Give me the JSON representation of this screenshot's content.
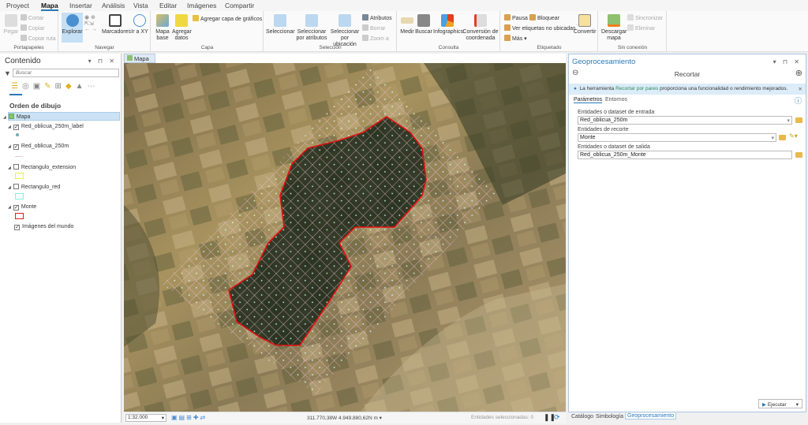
{
  "ribbon_tabs": [
    "Proyect",
    "Mapa",
    "Insertar",
    "Análisis",
    "Vista",
    "Editar",
    "Imágenes",
    "Compartir"
  ],
  "active_tab": "Mapa",
  "groups": {
    "portapapeles": {
      "label": "Portapapeles",
      "pegar": "Pegar",
      "cortar": "Cortar",
      "copiar": "Copiar",
      "copiar_ruta": "Copiar ruta"
    },
    "navegar": {
      "label": "Navegar",
      "explorar": "Explorar",
      "marcadores": "Marcadores",
      "ir_xy": "Ir a XY"
    },
    "capa": {
      "label": "Capa",
      "mapa_base": "Mapa base",
      "agregar_datos": "Agregar datos",
      "agregar_capa_graficos": "Agregar capa de gráficos"
    },
    "seleccion": {
      "label": "Selección",
      "seleccionar": "Seleccionar",
      "por_atributos": "Seleccionar por atributos",
      "por_ubicacion": "Seleccionar por ubicación",
      "atributos": "Atributos",
      "borrar": "Borrar",
      "zoom_a": "Zoom a"
    },
    "consulta": {
      "label": "Consulta",
      "medir": "Medir",
      "buscar": "Buscar",
      "infographics": "Infographics",
      "conversion": "Conversión de coordenada"
    },
    "etiquetado": {
      "label": "Etiquetado",
      "pausa": "Pausa",
      "bloquear": "Bloquear",
      "ver_etiquetas": "Ver etiquetas no ubicadas",
      "mas": "Más",
      "convertir": "Convertir"
    },
    "sin_conexion": {
      "label": "Sin conexión",
      "descargar": "Descargar mapa",
      "sincronizar": "Sincronizar",
      "eliminar": "Eliminar"
    }
  },
  "contents": {
    "title": "Contenido",
    "search_placeholder": "Buscar",
    "drawing_order": "Orden de dibujo",
    "layers": [
      {
        "name": "Mapa",
        "checked": true
      },
      {
        "name": "Red_oblicua_250m_label",
        "checked": true
      },
      {
        "name": "Red_oblicua_250m",
        "checked": true
      },
      {
        "name": "Rectangulo_extension",
        "checked": false,
        "color": "#f5f040"
      },
      {
        "name": "Rectangulo_red",
        "checked": false,
        "color": "#7ff0e0"
      },
      {
        "name": "Monte",
        "checked": true,
        "color": "#e02020"
      },
      {
        "name": "Imágenes del mundo",
        "checked": true
      }
    ]
  },
  "map": {
    "tab": "Mapa",
    "grid_color": "#f0c8d8",
    "monte_color": "#e01010"
  },
  "status": {
    "scale": "1:32.000",
    "coords": "311.770,38W 4.949.880,62N m",
    "selected": "Entidades seleccionadas: 0"
  },
  "geoproc": {
    "title": "Geoprocesamiento",
    "tool": "Recortar",
    "info_pre": "La herramienta ",
    "info_link": "Recortar por pares",
    "info_post": " proporciona una funcionalidad o rendimiento mejorados.",
    "tabs": [
      "Parámetros",
      "Entornos"
    ],
    "in_label": "Entidades o dataset de entrada",
    "in_value": "Red_oblicua_250m",
    "clip_label": "Entidades de recorte",
    "clip_value": "Monte",
    "out_label": "Entidades o dataset de salida",
    "out_value": "Red_oblicua_250m_Monte",
    "run": "Ejecutar"
  },
  "bottom_tabs": [
    "Catálogo",
    "Simbología",
    "Geoprocesamiento"
  ]
}
